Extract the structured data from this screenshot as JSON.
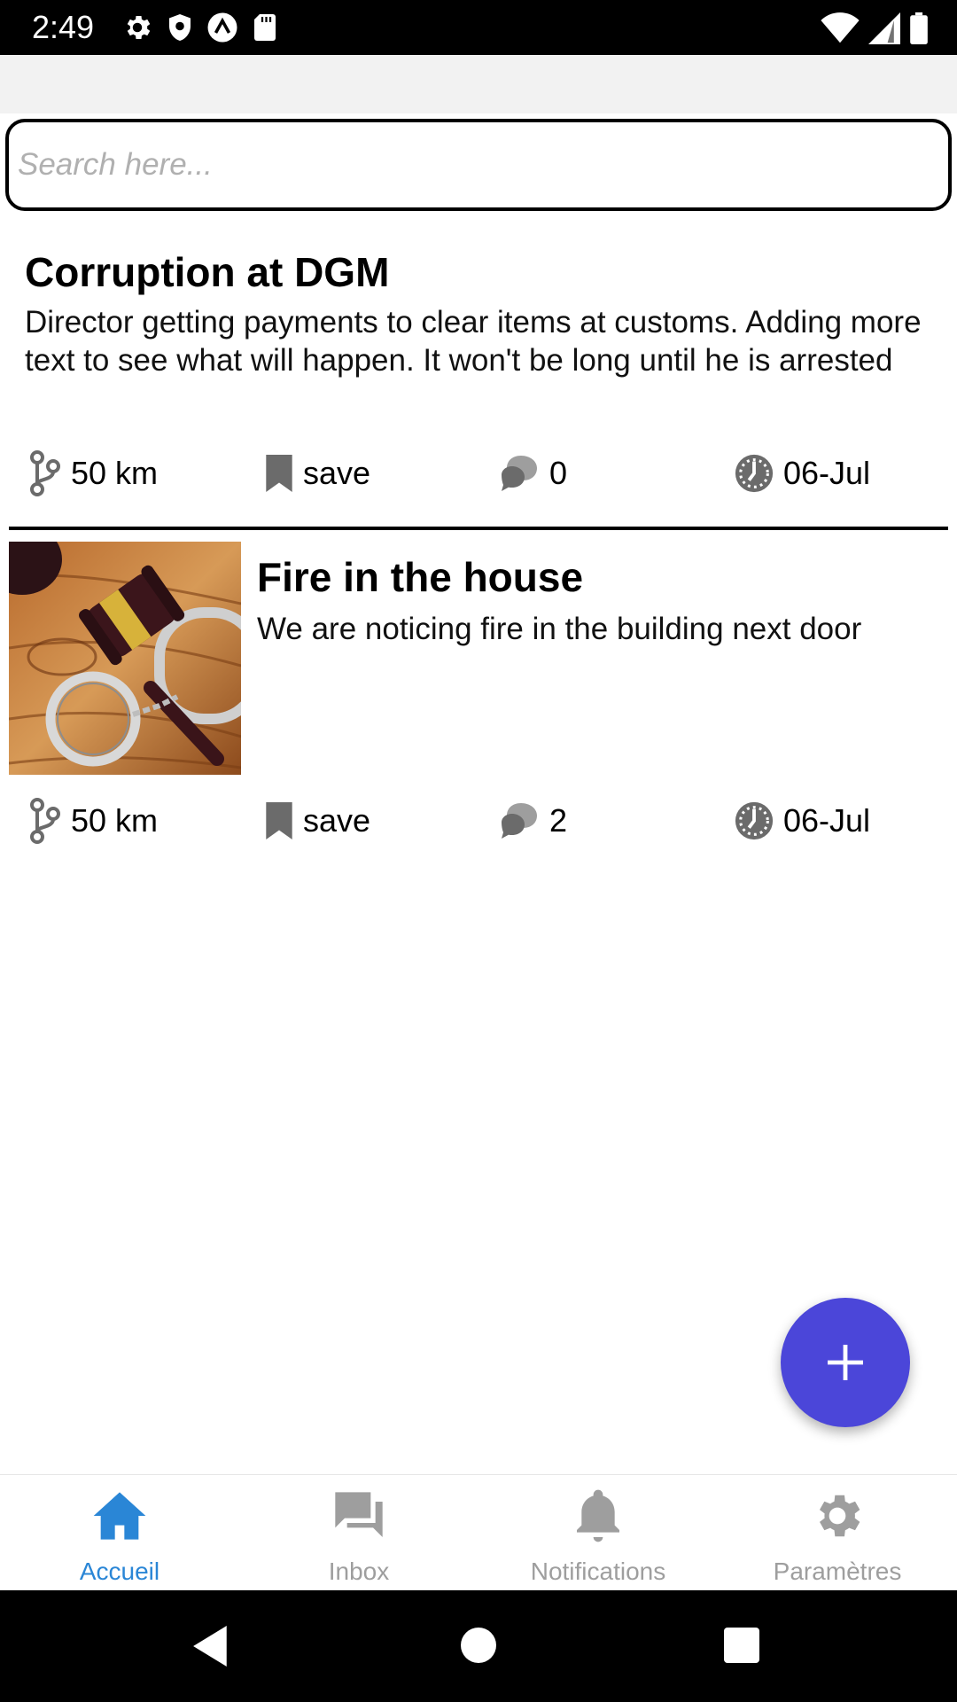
{
  "status_bar": {
    "time": "2:49",
    "left_icons": [
      "gear-icon",
      "shield-icon",
      "caret-circle-icon",
      "sd-card-icon"
    ],
    "right_icons": [
      "wifi-icon",
      "signal-icon",
      "battery-icon"
    ]
  },
  "search": {
    "placeholder": "Search here..."
  },
  "posts": [
    {
      "title": "Corruption at DGM",
      "description": "Director getting payments to clear items at customs.  Adding more text to see what will happen.  It won't be long until he is arrested",
      "distance": "50 km",
      "save_label": "save",
      "comments": "0",
      "date": "06-Jul",
      "has_image": false
    },
    {
      "title": "Fire in the house",
      "description": "We are noticing fire in the building next door",
      "distance": "50 km",
      "save_label": "save",
      "comments": "2",
      "date": "06-Jul",
      "has_image": true,
      "image_icon": "gavel-handcuffs-photo"
    }
  ],
  "fab": {
    "icon": "plus-icon"
  },
  "bottom_nav": [
    {
      "label": "Accueil",
      "icon": "home-icon",
      "active": true
    },
    {
      "label": "Inbox",
      "icon": "chat-bubbles-icon",
      "active": false
    },
    {
      "label": "Notifications",
      "icon": "bell-icon",
      "active": false
    },
    {
      "label": "Paramètres",
      "icon": "gear-icon",
      "active": false
    }
  ],
  "colors": {
    "accent": "#4b46d9",
    "active_nav": "#2a86d6",
    "inactive_nav": "#9e9e9e",
    "meta_icon": "#6b6b6b"
  }
}
